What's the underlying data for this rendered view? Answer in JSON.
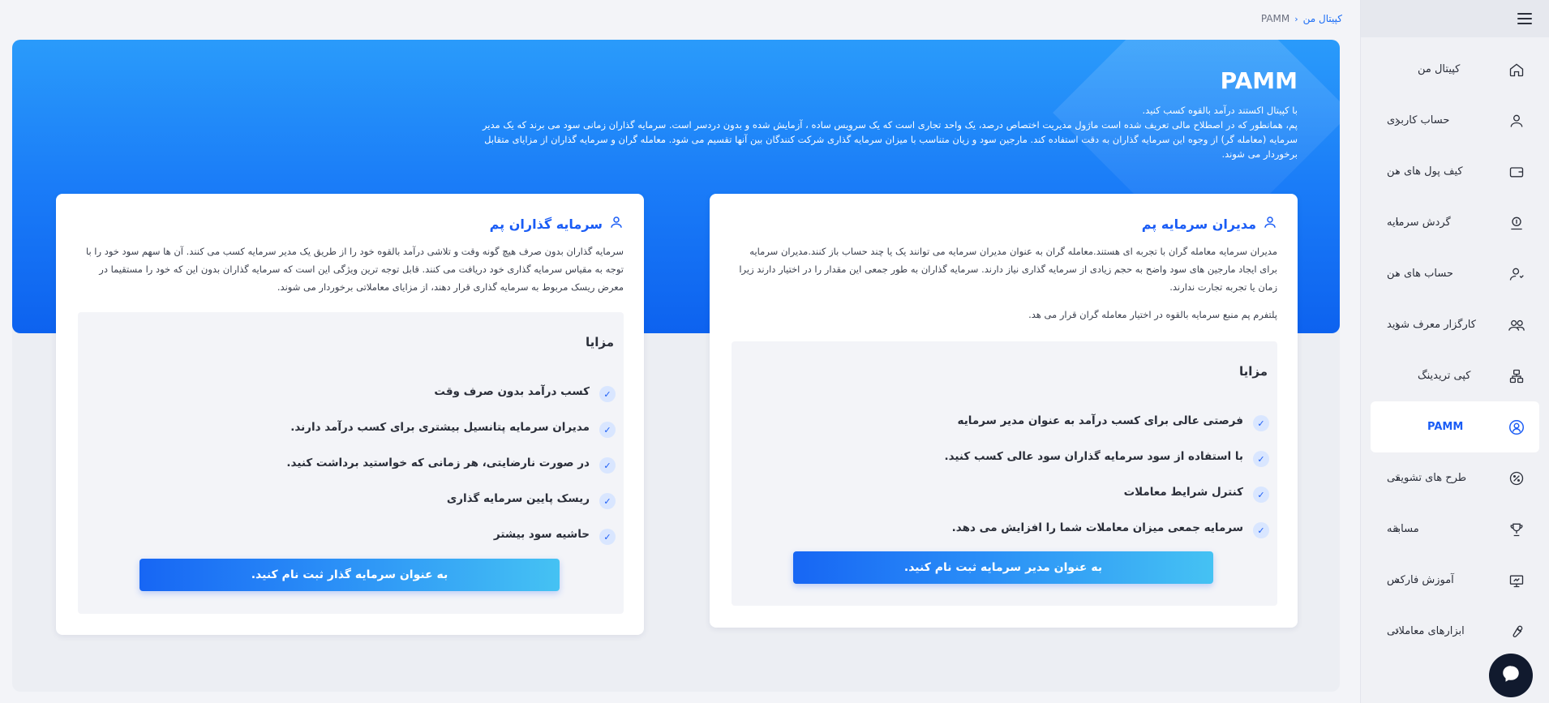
{
  "breadcrumb": {
    "home": "کپیتال من",
    "current": "PAMM"
  },
  "sidebar": {
    "items": [
      {
        "label": "کپیتال من",
        "icon": "home-icon",
        "chevron": false
      },
      {
        "label": "حساب کاربری",
        "icon": "user-icon",
        "chevron": true
      },
      {
        "label": "کیف پول های من",
        "icon": "wallet-icon",
        "chevron": true
      },
      {
        "label": "گردش سرمایه",
        "icon": "money-flow-icon",
        "chevron": true
      },
      {
        "label": "حساب های من",
        "icon": "user-account-icon",
        "chevron": true
      },
      {
        "label": "کارگزار معرف شوید",
        "icon": "users-icon",
        "chevron": true
      },
      {
        "label": "کپی تریدینگ",
        "icon": "copy-network-icon",
        "chevron": false
      },
      {
        "label": "PAMM",
        "icon": "pamm-icon",
        "chevron": false,
        "active": true
      },
      {
        "label": "طرح های تشویقی",
        "icon": "percent-badge-icon",
        "chevron": true
      },
      {
        "label": "مسابقه",
        "icon": "trophy-icon",
        "chevron": true
      },
      {
        "label": "آموزش فارکس",
        "icon": "education-icon",
        "chevron": true
      },
      {
        "label": "ابزارهای معاملاتی",
        "icon": "tools-icon",
        "chevron": true
      }
    ]
  },
  "hero": {
    "title": "PAMM",
    "line1": "با کپیتال اکستند درآمد بالقوه کسب کنید.",
    "line2": "پم، همانطور که در اصطلاح مالی تعریف شده است ماژول مدیریت اختصاص درصد، یک واحد تجاری است که یک سرویس ساده ، آزمایش شده و بدون دردسر است. سرمایه گذاران زمانی سود می برند که یک مدیر سرمایه (معامله گر) از وجوه این سرمایه گذاران به دقت استفاده کند. مارجین سود و زیان متناسب با میزان سرمایه گذاری شرکت کنندگان بین آنها تقسیم می شود. معامله گران و سرمایه گذاران از مزایای متقابل برخوردار می شوند."
  },
  "managers": {
    "title": "مدیران سرمایه پم",
    "desc": "مدیران سرمایه معامله گران با تجربه ای هستند.معامله گران به عنوان مدیران سرمایه می توانند یک یا چند حساب باز کنند.مدیران سرمایه برای ایجاد مارجین های سود واضح به حجم زیادی از سرمایه گذاری نیاز دارند. سرمایه گذاران به طور جمعی این مقدار را در اختیار دارند زیرا زمان یا تجربه تجارت ندارند.",
    "desc2": "پلتفرم پم منبع سرمایه بالقوه در اختیار معامله گران قرار می هد.",
    "benefits_title": "مزایا",
    "benefits": [
      "فرصتی عالی برای کسب درآمد به عنوان مدیر سرمایه",
      "با استفاده از سود سرمایه گذاران سود عالی کسب کنید.",
      "کنترل شرایط معاملات",
      "سرمایه جمعی میزان معاملات شما را افزایش می دهد."
    ],
    "cta": "به عنوان مدیر سرمایه ثبت نام کنید."
  },
  "investors": {
    "title": "سرمایه گذاران پم",
    "desc": "سرمایه گذاران بدون صرف هیچ گونه وقت و تلاشی درآمد بالقوه خود را از طریق یک مدیر سرمایه کسب می کنند. آن ها سهم سود خود را با توجه به مقیاس سرمایه گذاری خود دریافت می کنند. قابل توجه ترین ویژگی این است که سرمایه گذاران بدون این که خود را مستقیما در معرض ریسک مربوط به سرمایه گذاری قرار دهند، از مزایای معاملاتی برخوردار می شوند.",
    "benefits_title": "مزایا",
    "benefits": [
      "کسب درآمد بدون صرف وقت",
      "مدیران سرمایه پتانسیل بیشتری برای کسب درآمد دارند.",
      "در صورت نارضایتی، هر زمانی که خواستید برداشت کنید.",
      "ریسک پایین سرمایه گذاری",
      "حاشیه سود بیشتر"
    ],
    "cta": "به عنوان سرمایه گذار ثبت نام کنید."
  },
  "colors": {
    "accent": "#1a5cf5",
    "hero_top": "#2a9bfa",
    "hero_bottom": "#0d62ef"
  }
}
